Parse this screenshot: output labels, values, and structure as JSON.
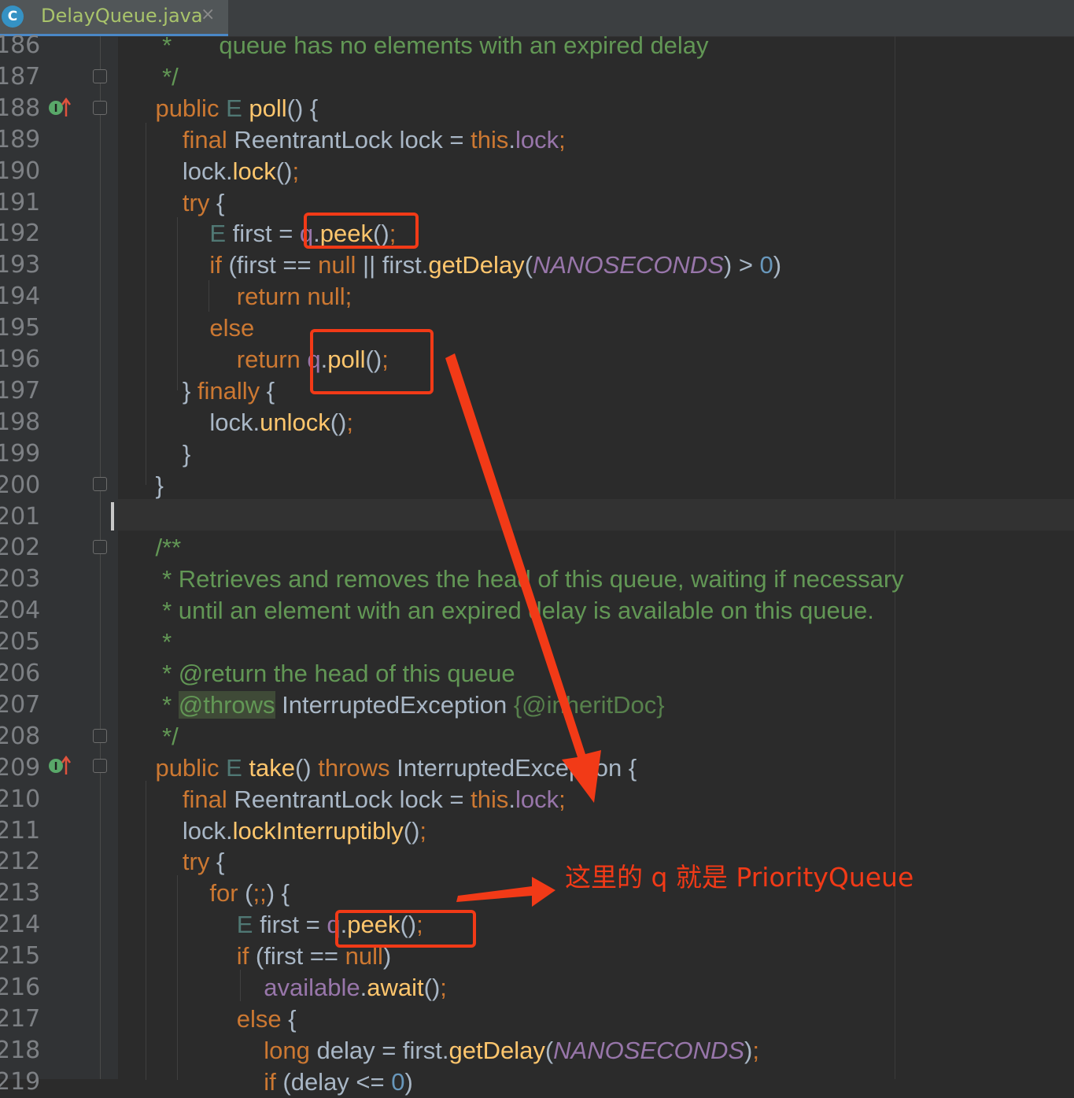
{
  "tab": {
    "icon_letter": "C",
    "title": "DelayQueue.java",
    "close": "×"
  },
  "lines": [
    {
      "n": "186",
      "parts": [
        [
          "cm",
          "     *       queue has no elements with an expired delay"
        ]
      ]
    },
    {
      "n": "187",
      "parts": [
        [
          "cm",
          "     */"
        ]
      ]
    },
    {
      "n": "188",
      "parts": [
        [
          "kw",
          "    public "
        ],
        [
          "tp",
          "E "
        ],
        [
          "fn",
          "poll"
        ],
        [
          "",
          "() {"
        ]
      ]
    },
    {
      "n": "189",
      "parts": [
        [
          "kw",
          "        final "
        ],
        [
          "",
          "ReentrantLock lock = "
        ],
        [
          "kw",
          "this"
        ],
        [
          "",
          "."
        ],
        [
          "fld",
          "lock"
        ],
        [
          "kw",
          ";"
        ]
      ]
    },
    {
      "n": "190",
      "parts": [
        [
          "",
          "        lock."
        ],
        [
          "fn",
          "lock"
        ],
        [
          "",
          "()"
        ],
        [
          "kw",
          ";"
        ]
      ]
    },
    {
      "n": "191",
      "parts": [
        [
          "kw",
          "        try "
        ],
        [
          "",
          "{"
        ]
      ]
    },
    {
      "n": "192",
      "parts": [
        [
          "tp",
          "            E "
        ],
        [
          "",
          "first = "
        ],
        [
          "fld",
          "q"
        ],
        [
          "",
          "."
        ],
        [
          "fn",
          "peek"
        ],
        [
          "",
          "()"
        ],
        [
          "kw",
          ";"
        ]
      ]
    },
    {
      "n": "193",
      "parts": [
        [
          "kw",
          "            if "
        ],
        [
          "",
          "(first == "
        ],
        [
          "kw",
          "null "
        ],
        [
          "",
          "|| first."
        ],
        [
          "fn",
          "getDelay"
        ],
        [
          "",
          "("
        ],
        [
          "cst",
          "NANOSECONDS"
        ],
        [
          "",
          ") > "
        ],
        [
          "num",
          "0"
        ],
        [
          "",
          ")"
        ]
      ]
    },
    {
      "n": "194",
      "parts": [
        [
          "kw",
          "                return null;"
        ]
      ]
    },
    {
      "n": "195",
      "parts": [
        [
          "kw",
          "            else"
        ]
      ]
    },
    {
      "n": "196",
      "parts": [
        [
          "kw",
          "                return "
        ],
        [
          "fld",
          "q"
        ],
        [
          "",
          "."
        ],
        [
          "fn",
          "poll"
        ],
        [
          "",
          "()"
        ],
        [
          "kw",
          ";"
        ]
      ]
    },
    {
      "n": "197",
      "parts": [
        [
          "",
          "        } "
        ],
        [
          "kw",
          "finally "
        ],
        [
          "",
          "{"
        ]
      ]
    },
    {
      "n": "198",
      "parts": [
        [
          "",
          "            lock."
        ],
        [
          "fn",
          "unlock"
        ],
        [
          "",
          "()"
        ],
        [
          "kw",
          ";"
        ]
      ]
    },
    {
      "n": "199",
      "parts": [
        [
          "",
          "        }"
        ]
      ]
    },
    {
      "n": "200",
      "parts": [
        [
          "",
          "    }"
        ]
      ]
    },
    {
      "n": "201",
      "parts": [
        [
          "",
          ""
        ]
      ]
    },
    {
      "n": "202",
      "parts": [
        [
          "cm",
          "    /**"
        ]
      ]
    },
    {
      "n": "203",
      "parts": [
        [
          "cm",
          "     * Retrieves and removes the head of this queue, waiting if necessary"
        ]
      ]
    },
    {
      "n": "204",
      "parts": [
        [
          "cm",
          "     * until an element with an expired delay is available on this queue."
        ]
      ]
    },
    {
      "n": "205",
      "parts": [
        [
          "cm",
          "     *"
        ]
      ]
    },
    {
      "n": "206",
      "parts": [
        [
          "cm",
          "     * @return the head of this queue"
        ]
      ]
    },
    {
      "n": "207",
      "parts": [
        [
          "cm",
          "     * "
        ],
        [
          "tag",
          "@throws"
        ],
        [
          "",
          " InterruptedException "
        ],
        [
          "cmg",
          "{@inheritDoc}"
        ]
      ]
    },
    {
      "n": "208",
      "parts": [
        [
          "cm",
          "     */"
        ]
      ]
    },
    {
      "n": "209",
      "parts": [
        [
          "kw",
          "    public "
        ],
        [
          "tp",
          "E "
        ],
        [
          "fn",
          "take"
        ],
        [
          "",
          "() "
        ],
        [
          "kw",
          "throws "
        ],
        [
          "",
          "InterruptedException {"
        ]
      ]
    },
    {
      "n": "210",
      "parts": [
        [
          "kw",
          "        final "
        ],
        [
          "",
          "ReentrantLock lock = "
        ],
        [
          "kw",
          "this"
        ],
        [
          "",
          "."
        ],
        [
          "fld",
          "lock"
        ],
        [
          "kw",
          ";"
        ]
      ]
    },
    {
      "n": "211",
      "parts": [
        [
          "",
          "        lock."
        ],
        [
          "fn",
          "lockInterruptibly"
        ],
        [
          "",
          "()"
        ],
        [
          "kw",
          ";"
        ]
      ]
    },
    {
      "n": "212",
      "parts": [
        [
          "kw",
          "        try "
        ],
        [
          "",
          "{"
        ]
      ]
    },
    {
      "n": "213",
      "parts": [
        [
          "kw",
          "            for "
        ],
        [
          "",
          "("
        ],
        [
          "kw",
          ";;"
        ],
        [
          "",
          ") {"
        ]
      ]
    },
    {
      "n": "214",
      "parts": [
        [
          "tp",
          "                E "
        ],
        [
          "",
          "first = "
        ],
        [
          "fld",
          "q"
        ],
        [
          "",
          "."
        ],
        [
          "fn",
          "peek"
        ],
        [
          "",
          "()"
        ],
        [
          "kw",
          ";"
        ]
      ]
    },
    {
      "n": "215",
      "parts": [
        [
          "kw",
          "                if "
        ],
        [
          "",
          "(first == "
        ],
        [
          "kw",
          "null"
        ],
        [
          "",
          ")"
        ]
      ]
    },
    {
      "n": "216",
      "parts": [
        [
          "fld",
          "                    available"
        ],
        [
          "",
          "."
        ],
        [
          "fn",
          "await"
        ],
        [
          "",
          "()"
        ],
        [
          "kw",
          ";"
        ]
      ]
    },
    {
      "n": "217",
      "parts": [
        [
          "kw",
          "                else "
        ],
        [
          "",
          "{"
        ]
      ]
    },
    {
      "n": "218",
      "parts": [
        [
          "kw",
          "                    long "
        ],
        [
          "",
          "delay = first."
        ],
        [
          "fn",
          "getDelay"
        ],
        [
          "",
          "("
        ],
        [
          "cst",
          "NANOSECONDS"
        ],
        [
          "",
          ")"
        ],
        [
          "kw",
          ";"
        ]
      ]
    },
    {
      "n": "219",
      "parts": [
        [
          "kw",
          "                    if "
        ],
        [
          "",
          "(delay <= "
        ],
        [
          "num",
          "0"
        ],
        [
          "",
          ")"
        ]
      ]
    }
  ],
  "annotation": {
    "label": "这里的 q 就是 PriorityQueue",
    "color": "#f23a17"
  },
  "colors": {
    "background": "#2b2b2b",
    "keyword": "#cc7832",
    "method": "#ffc66d",
    "field": "#9876aa",
    "comment": "#629755",
    "number": "#6897bb"
  }
}
